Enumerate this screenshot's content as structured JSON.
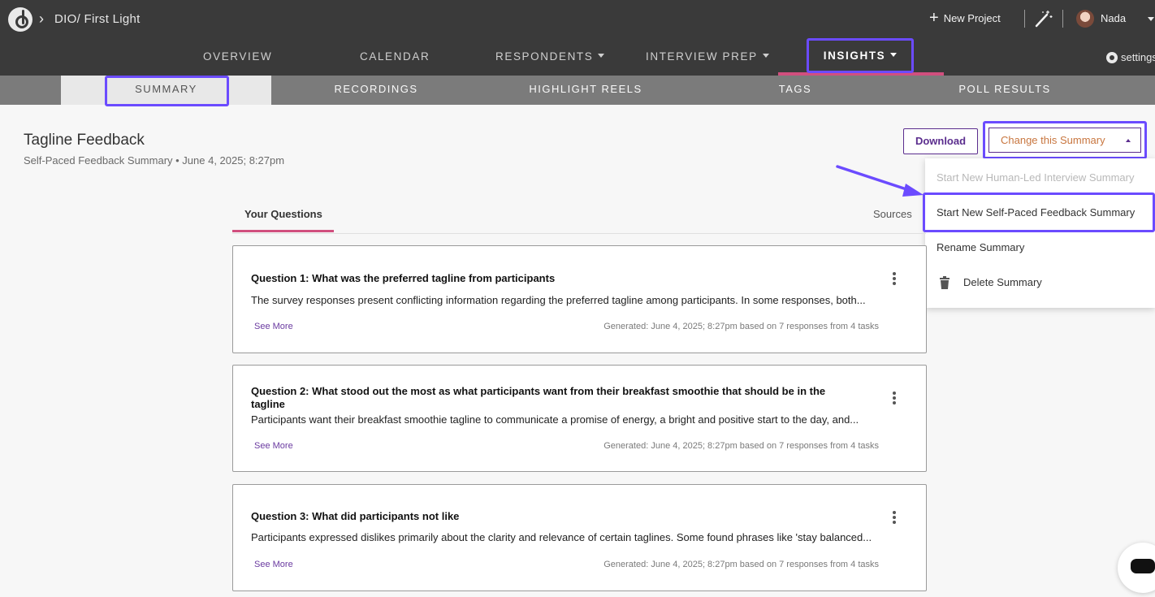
{
  "header": {
    "breadcrumb": "DIO/ First Light",
    "new_project": "New Project",
    "user_name": "Nada",
    "settings": "settings"
  },
  "nav": {
    "overview": "OVERVIEW",
    "calendar": "CALENDAR",
    "respondents": "RESPONDENTS",
    "interview_prep": "INTERVIEW PREP",
    "insights": "INSIGHTS"
  },
  "subnav": {
    "summary": "SUMMARY",
    "recordings": "RECORDINGS",
    "highlight_reels": "HIGHLIGHT REELS",
    "tags": "TAGS",
    "poll_results": "POLL RESULTS"
  },
  "page": {
    "title": "Tagline Feedback",
    "subtitle": "Self-Paced Feedback Summary • June 4, 2025; 8:27pm",
    "download": "Download",
    "change_summary": "Change this Summary"
  },
  "dropdown": {
    "items": [
      "Start New Human-Led Interview Summary",
      "Start New Self-Paced Feedback Summary",
      "Rename Summary",
      "Delete Summary"
    ]
  },
  "tabs": {
    "your_questions": "Your Questions",
    "sources": "Sources"
  },
  "questions": [
    {
      "title": "Question 1: What was the preferred tagline from participants",
      "answer": "The survey responses present conflicting information regarding the preferred tagline among participants. In some responses, both...",
      "see_more": "See More",
      "generated": "Generated: June 4, 2025; 8:27pm based on 7 responses from 4 tasks"
    },
    {
      "title": "Question 2: What stood out the most as what participants want from their breakfast smoothie that should be in the tagline",
      "answer": "Participants want their breakfast smoothie tagline to communicate a promise of energy, a bright and positive start to the day, and...",
      "see_more": "See More",
      "generated": "Generated: June 4, 2025; 8:27pm based on 7 responses from 4 tasks"
    },
    {
      "title": "Question 3: What did participants not like",
      "answer": "Participants expressed dislikes primarily about the clarity and relevance of certain taglines. Some found phrases like 'stay balanced...",
      "see_more": "See More",
      "generated": "Generated: June 4, 2025; 8:27pm based on 7 responses from 4 tasks"
    }
  ],
  "colors": {
    "highlight": "#6b4bff",
    "accent_pink": "#d14f7e",
    "brand_purple": "#5b2d8e"
  }
}
